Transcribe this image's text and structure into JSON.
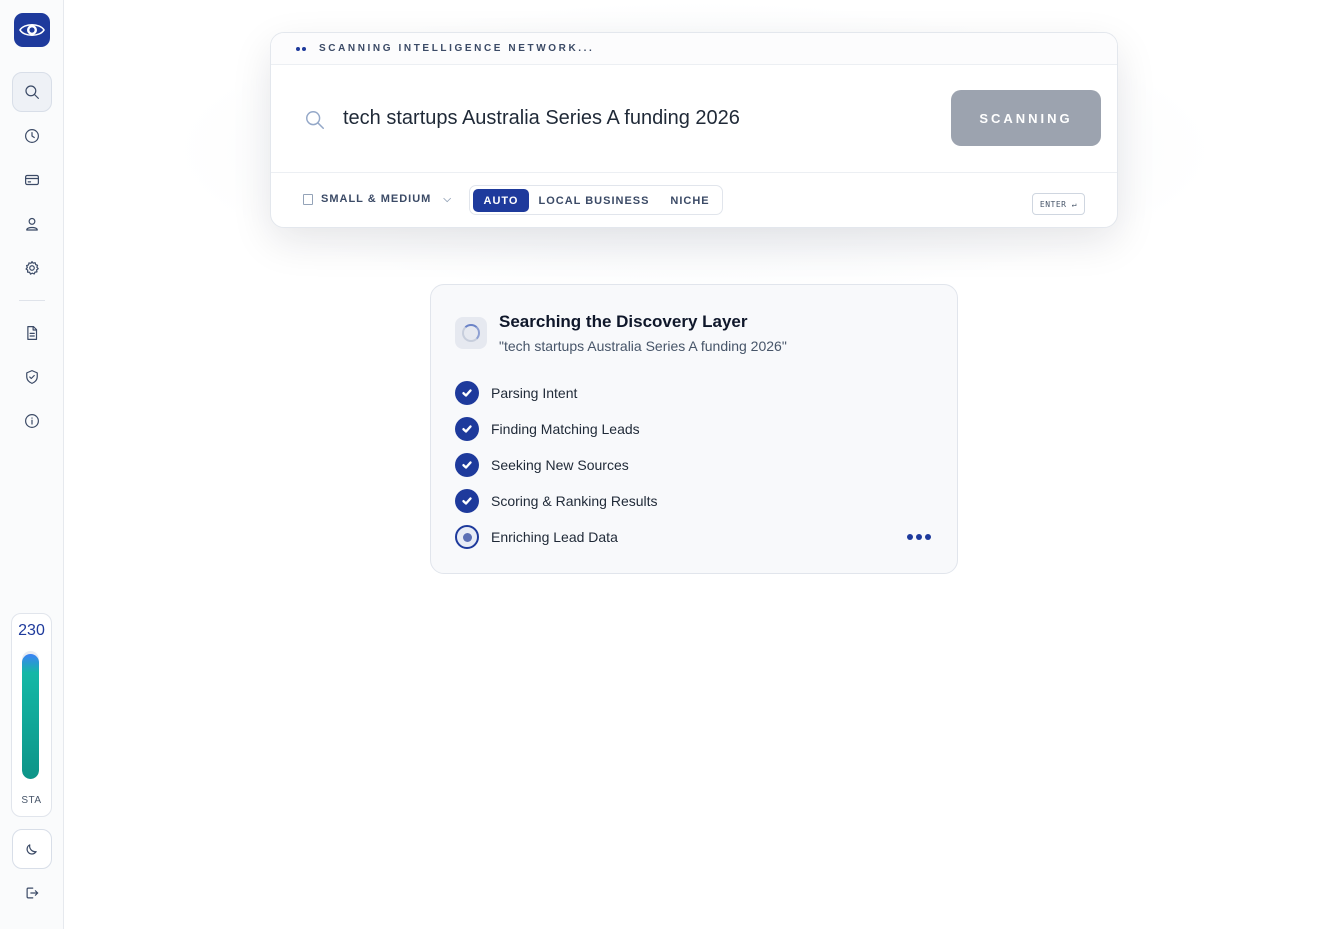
{
  "sidebar": {
    "logo_icon": "eye-icon",
    "nav_top": [
      {
        "name": "search",
        "icon": "search-icon",
        "active": true
      },
      {
        "name": "history",
        "icon": "clock-icon"
      },
      {
        "name": "billing",
        "icon": "credit-card-icon"
      },
      {
        "name": "profile",
        "icon": "user-icon"
      },
      {
        "name": "settings",
        "icon": "gear-icon"
      }
    ],
    "nav_bottom": [
      {
        "name": "documents",
        "icon": "document-icon"
      },
      {
        "name": "security",
        "icon": "shield-check-icon"
      },
      {
        "name": "info",
        "icon": "info-icon"
      }
    ],
    "credits": {
      "value": "230",
      "label": "STA",
      "fill_fraction": 0.98
    },
    "theme_icon": "moon-icon",
    "logout_icon": "logout-icon"
  },
  "search": {
    "status": "SCANNING INTELLIGENCE NETWORK...",
    "query": "tech startups Australia Series A funding 2026",
    "button_label": "SCANNING",
    "size_filter": "SMALL & MEDIUM",
    "modes": [
      "AUTO",
      "LOCAL BUSINESS",
      "NICHE"
    ],
    "active_mode": "AUTO",
    "enter_hint": "ENTER ↵"
  },
  "progress": {
    "title": "Searching the Discovery Layer",
    "query": "\"tech startups Australia Series A funding 2026\"",
    "steps": [
      {
        "label": "Parsing Intent",
        "status": "done"
      },
      {
        "label": "Finding Matching Leads",
        "status": "done"
      },
      {
        "label": "Seeking New Sources",
        "status": "done"
      },
      {
        "label": "Scoring & Ranking Results",
        "status": "done"
      },
      {
        "label": "Enriching Lead Data",
        "status": "in-progress"
      }
    ]
  },
  "colors": {
    "brand": "#1e3a9c",
    "button_disabled": "#9ca3af",
    "credits_gradient_start": "#3b82f6",
    "credits_gradient_end": "#0d9488"
  }
}
